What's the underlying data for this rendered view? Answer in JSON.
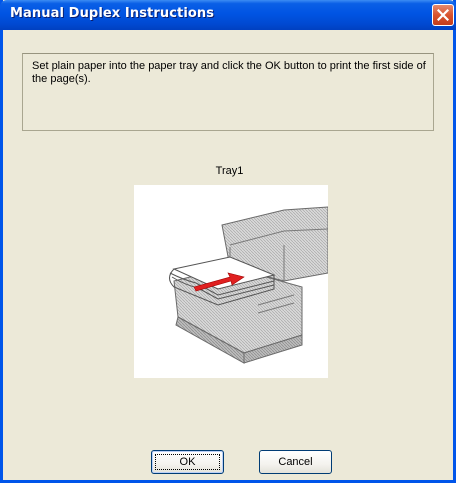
{
  "window": {
    "title": "Manual Duplex Instructions",
    "close_icon": "close-icon",
    "accent_color": "#0054E3"
  },
  "message": "Set plain paper into the paper tray and click the OK button to print the first side of the page(s).",
  "tray": {
    "label": "Tray1",
    "image": "printer-paper-tray-illustration"
  },
  "buttons": {
    "ok_label": "OK",
    "cancel_label": "Cancel"
  }
}
